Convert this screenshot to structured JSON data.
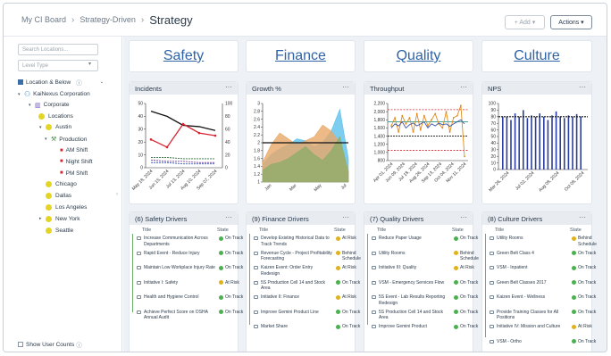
{
  "breadcrumb": {
    "root": "My CI Board",
    "mid": "Strategy-Driven",
    "current": "Strategy"
  },
  "toolbar": {
    "add_label": "+ Add ▾",
    "actions_label": "Actions ▾"
  },
  "sidebar": {
    "search_placeholder": "Search Locations...",
    "level_placeholder": "Level Type",
    "location_below": "Location & Below",
    "show_user_counts": "Show User Counts",
    "items": [
      {
        "label": "KaiNexus Corporation",
        "kind": "org"
      },
      {
        "label": "Corporate",
        "kind": "building"
      },
      {
        "label": "Locations",
        "kind": "dot"
      },
      {
        "label": "Austin",
        "kind": "dot"
      },
      {
        "label": "Production",
        "kind": "tool"
      },
      {
        "label": "AM Shift",
        "kind": "truck"
      },
      {
        "label": "Night Shift",
        "kind": "truck"
      },
      {
        "label": "PM Shift",
        "kind": "truck"
      },
      {
        "label": "Chicago",
        "kind": "dot"
      },
      {
        "label": "Dallas",
        "kind": "dot"
      },
      {
        "label": "Los Angeles",
        "kind": "dot"
      },
      {
        "label": "New York",
        "kind": "dot"
      },
      {
        "label": "Seattle",
        "kind": "dot"
      }
    ]
  },
  "categories": [
    "Safety",
    "Finance",
    "Quality",
    "Culture"
  ],
  "charts": [
    {
      "title": "Incidents",
      "menu": "···"
    },
    {
      "title": "Growth %",
      "menu": "···"
    },
    {
      "title": "Throughput",
      "menu": "···"
    },
    {
      "title": "NPS",
      "menu": "···"
    }
  ],
  "chart_data": [
    {
      "type": "line",
      "title": "Incidents",
      "categories": [
        "May 18, 2024",
        "Jun 15, 2024",
        "Jul 13, 2024",
        "Aug 10, 2024",
        "Sep 07, 2024"
      ],
      "ylim": [
        0,
        50
      ],
      "y2lim": [
        0,
        100
      ],
      "yticks": [
        0,
        10,
        20,
        30,
        40,
        50
      ],
      "y2ticks": [
        0,
        20,
        40,
        60,
        80,
        100
      ],
      "series": [
        {
          "color": "#111111",
          "values": [
            44,
            40,
            33,
            32,
            29
          ]
        },
        {
          "color": "#d9242f",
          "values": [
            22,
            16,
            34,
            27,
            25
          ]
        },
        {
          "color": "#2d6d3a",
          "values": [
            8,
            8,
            7,
            7,
            7
          ]
        },
        {
          "color": "#7a3fa0",
          "values": [
            6,
            5,
            5,
            4,
            4
          ]
        },
        {
          "color": "#3358b8",
          "values": [
            4,
            4,
            3,
            3,
            3
          ]
        }
      ]
    },
    {
      "type": "area",
      "title": "Growth %",
      "categories": [
        "Jan",
        "Mar",
        "May",
        "Jul"
      ],
      "x": [
        0,
        1,
        2,
        3,
        4,
        5,
        6,
        7,
        8,
        9,
        10
      ],
      "ylim": [
        1,
        3
      ],
      "yticks": [
        1,
        1.2,
        1.4,
        1.6,
        1.8,
        2,
        2.2,
        2.4,
        2.6,
        2.8,
        3
      ],
      "series": [
        {
          "color": "#5bc0eb",
          "values": [
            1.45,
            1.7,
            1.85,
            1.95,
            2.1,
            2.05,
            1.9,
            2.0,
            2.3,
            2.85,
            1.6
          ]
        },
        {
          "color": "#e8a868",
          "values": [
            1.5,
            1.95,
            2.25,
            2.1,
            1.95,
            2.05,
            2.15,
            2.45,
            2.3,
            2.0,
            1.3
          ]
        },
        {
          "color": "#8fac6a",
          "values": [
            1.3,
            1.45,
            1.5,
            1.6,
            1.75,
            1.9,
            1.7,
            1.55,
            1.8,
            2.15,
            1.25
          ]
        }
      ],
      "target": 2.0
    },
    {
      "type": "line",
      "title": "Throughput",
      "categories": [
        "Apr 01, 2024",
        "Jun 09, 2024",
        "Jul 18, 2024",
        "Aug 26, 2024",
        "Sep 13, 2024",
        "Oct 04, 2024",
        "Nov 11, 2024"
      ],
      "ylim": [
        800,
        2200
      ],
      "yticks": [
        800,
        1000,
        1200,
        1400,
        1600,
        1800,
        2000,
        2200
      ],
      "series": [
        {
          "color": "#e08a1e",
          "values": [
            1650,
            1850,
            1500,
            1900,
            1700,
            1850,
            1500,
            1950,
            1550,
            1900,
            1650,
            1800,
            1950,
            1700,
            1600,
            2000,
            1500,
            1850,
            1900,
            2150,
            900
          ]
        },
        {
          "color": "#3a55a8",
          "values": [
            1600,
            1700,
            1650,
            1750,
            1600,
            1680,
            1720,
            1650,
            1700,
            1750,
            1600,
            1700,
            1650,
            1720,
            1680,
            1700,
            1640,
            1700,
            1750,
            1800,
            1700
          ]
        }
      ],
      "ucl": 2050,
      "lcl": 1050,
      "mean": 1750,
      "target": 1400
    },
    {
      "type": "bar",
      "title": "NPS",
      "categories": [
        "Mar 26, 2024",
        "Jul 02, 2024",
        "Aug 08, 2024",
        "Oct 08, 2024"
      ],
      "ylim": [
        0,
        100
      ],
      "yticks": [
        0,
        10,
        20,
        30,
        40,
        50,
        60,
        70,
        80,
        90,
        100
      ],
      "values": [
        80,
        80,
        75,
        85,
        80,
        90,
        78,
        82,
        80,
        85,
        80,
        75,
        82,
        88,
        80,
        78,
        82,
        80,
        84,
        80
      ],
      "target": 80
    }
  ],
  "drivers": [
    {
      "title": "(6) Safety Drivers",
      "items": [
        {
          "t": "Increase Communication Across Departments",
          "s": "On Track",
          "c": "#4caf50"
        },
        {
          "t": "Rapid Event - Reduce Injury",
          "s": "On Track",
          "c": "#4caf50"
        },
        {
          "t": "Maintain Low Workplace Injury Rate",
          "s": "On Track",
          "c": "#4caf50"
        },
        {
          "t": "Initiative I: Safety",
          "s": "At Risk",
          "c": "#e0b21c"
        },
        {
          "t": "Health and Hygiene Control",
          "s": "On Track",
          "c": "#4caf50"
        },
        {
          "t": "Achieve Perfect Score on OSHA Annual Audit",
          "s": "On Track",
          "c": "#4caf50"
        }
      ]
    },
    {
      "title": "(9) Finance Drivers",
      "items": [
        {
          "t": "Develop Existing Historical Data to Track Trends",
          "s": "At Risk",
          "c": "#e0b21c"
        },
        {
          "t": "Revenue Cycle - Project Profitability Forecasting",
          "s": "Behind Schedule",
          "c": "#e0b21c"
        },
        {
          "t": "Kaizen Event: Order Entry Redesign",
          "s": "At Risk",
          "c": "#e0b21c"
        },
        {
          "t": "5S Production Cell 14 and Stock Area",
          "s": "On Track",
          "c": "#4caf50"
        },
        {
          "t": "Initiative II: Finance",
          "s": "At Risk",
          "c": "#e0b21c"
        },
        {
          "t": "Improve Gemini Product Line",
          "s": "On Track",
          "c": "#4caf50"
        },
        {
          "t": "Market Share",
          "s": "On Track",
          "c": "#4caf50"
        }
      ]
    },
    {
      "title": "(7) Quality Drivers",
      "items": [
        {
          "t": "Reduce Paper Usage",
          "s": "On Track",
          "c": "#4caf50"
        },
        {
          "t": "Utility Rooms",
          "s": "Behind Schedule",
          "c": "#e0b21c"
        },
        {
          "t": "Initiative III: Quality",
          "s": "At Risk",
          "c": "#e0b21c"
        },
        {
          "t": "VSM - Emergency Services Flow",
          "s": "On Track",
          "c": "#4caf50"
        },
        {
          "t": "5S Event - Lab Results Reporting Redesign",
          "s": "On Track",
          "c": "#4caf50"
        },
        {
          "t": "5S Production Cell 14 and Stock Area",
          "s": "On Track",
          "c": "#4caf50"
        },
        {
          "t": "Improve Gemini Product",
          "s": "On Track",
          "c": "#4caf50"
        }
      ]
    },
    {
      "title": "(8) Culture Drivers",
      "items": [
        {
          "t": "Utility Rooms",
          "s": "Behind Schedule",
          "c": "#e0b21c"
        },
        {
          "t": "Green Belt Class 4",
          "s": "On Track",
          "c": "#4caf50"
        },
        {
          "t": "VSM - Inpatient",
          "s": "On Track",
          "c": "#4caf50"
        },
        {
          "t": "Green Belt Classes 2017",
          "s": "On Track",
          "c": "#4caf50"
        },
        {
          "t": "Kaizen Event - Wellness",
          "s": "On Track",
          "c": "#4caf50"
        },
        {
          "t": "Provide Training Classes for All Positions",
          "s": "On Track",
          "c": "#4caf50"
        },
        {
          "t": "Initiative IV: Mission and Culture",
          "s": "At Risk",
          "c": "#e0b21c"
        },
        {
          "t": "VSM - Ortho",
          "s": "On Track",
          "c": "#4caf50"
        }
      ]
    }
  ],
  "driver_cols": {
    "title": "Title",
    "state": "State"
  }
}
